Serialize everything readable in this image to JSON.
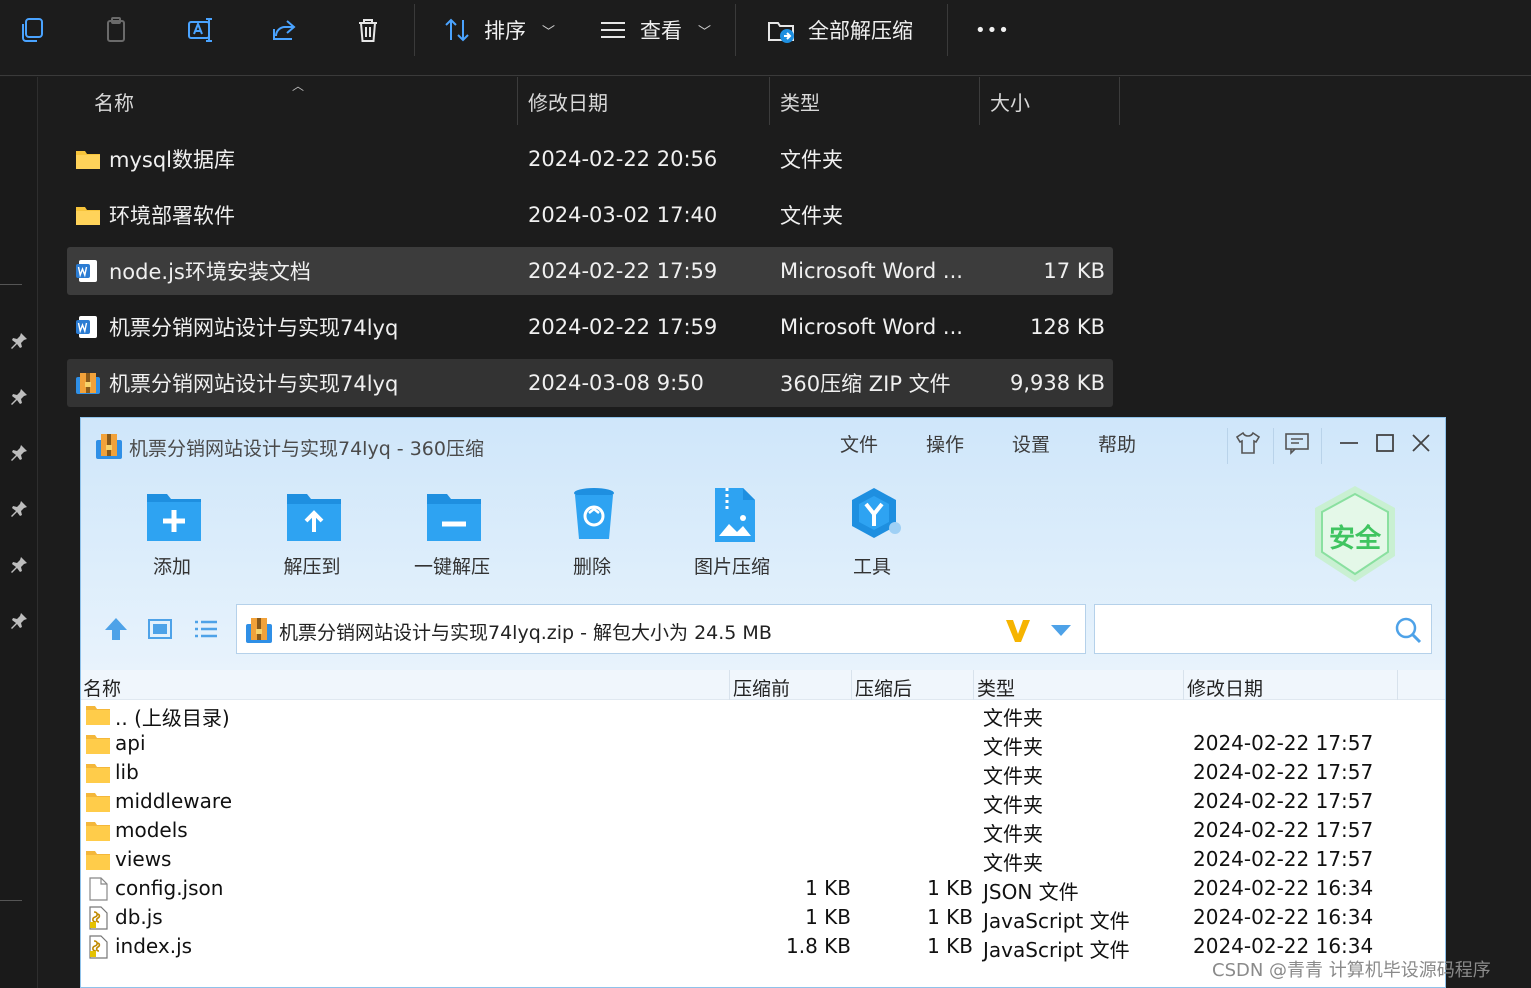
{
  "explorer": {
    "toolbar": {
      "sort_label": "排序",
      "view_label": "查看",
      "extract_all_label": "全部解压缩",
      "more_label": "•••"
    },
    "columns": {
      "name": "名称",
      "modified": "修改日期",
      "type": "类型",
      "size": "大小"
    },
    "files": [
      {
        "name": "mysql数据库",
        "modified": "2024-02-22 20:56",
        "type": "文件夹",
        "size": "",
        "icon": "folder-icon"
      },
      {
        "name": "环境部署软件",
        "modified": "2024-03-02 17:40",
        "type": "文件夹",
        "size": "",
        "icon": "folder-icon"
      },
      {
        "name": "node.js环境安装文档",
        "modified": "2024-02-22 17:59",
        "type": "Microsoft Word ...",
        "size": "17 KB",
        "icon": "word-doc-icon"
      },
      {
        "name": "机票分销网站设计与实现74lyq",
        "modified": "2024-02-22 17:59",
        "type": "Microsoft Word ...",
        "size": "128 KB",
        "icon": "word-doc-icon"
      },
      {
        "name": "机票分销网站设计与实现74lyq",
        "modified": "2024-03-08 9:50",
        "type": "360压缩 ZIP 文件",
        "size": "9,938 KB",
        "icon": "zip-archive-icon"
      }
    ]
  },
  "zip": {
    "title": "机票分销网站设计与实现74lyq - 360压缩",
    "menu": [
      "文件",
      "操作",
      "设置",
      "帮助"
    ],
    "tools": [
      {
        "label": "添加",
        "icon": "add-icon"
      },
      {
        "label": "解压到",
        "icon": "extract-to-icon"
      },
      {
        "label": "一键解压",
        "icon": "one-click-extract-icon"
      },
      {
        "label": "删除",
        "icon": "delete-icon"
      },
      {
        "label": "图片压缩",
        "icon": "image-compress-icon"
      },
      {
        "label": "工具",
        "icon": "tools-icon"
      }
    ],
    "safe_label": "安全",
    "path": "机票分销网站设计与实现74lyq.zip - 解包大小为 24.5 MB",
    "search_value": "",
    "columns": {
      "name": "名称",
      "before": "压缩前",
      "after": "压缩后",
      "type": "类型",
      "modified": "修改日期"
    },
    "entries": [
      {
        "name": ".. (上级目录)",
        "before": "",
        "after": "",
        "type": "文件夹",
        "modified": "",
        "icon": "folder-icon"
      },
      {
        "name": "api",
        "before": "",
        "after": "",
        "type": "文件夹",
        "modified": "2024-02-22 17:57",
        "icon": "folder-icon"
      },
      {
        "name": "lib",
        "before": "",
        "after": "",
        "type": "文件夹",
        "modified": "2024-02-22 17:57",
        "icon": "folder-icon"
      },
      {
        "name": "middleware",
        "before": "",
        "after": "",
        "type": "文件夹",
        "modified": "2024-02-22 17:57",
        "icon": "folder-icon"
      },
      {
        "name": "models",
        "before": "",
        "after": "",
        "type": "文件夹",
        "modified": "2024-02-22 17:57",
        "icon": "folder-icon"
      },
      {
        "name": "views",
        "before": "",
        "after": "",
        "type": "文件夹",
        "modified": "2024-02-22 17:57",
        "icon": "folder-icon"
      },
      {
        "name": "config.json",
        "before": "1 KB",
        "after": "1 KB",
        "type": "JSON 文件",
        "modified": "2024-02-22 16:34",
        "icon": "blank-file-icon"
      },
      {
        "name": "db.js",
        "before": "1 KB",
        "after": "1 KB",
        "type": "JavaScript 文件",
        "modified": "2024-02-22 16:34",
        "icon": "script-file-icon"
      },
      {
        "name": "index.js",
        "before": "1.8 KB",
        "after": "1 KB",
        "type": "JavaScript 文件",
        "modified": "2024-02-22 16:34",
        "icon": "script-file-icon"
      }
    ]
  },
  "watermark": "CSDN @青青  计算机毕设源码程序",
  "colors": {
    "explorer_bg": "#1c1c1c",
    "selection": "#3c3c3c",
    "zip_header": "#d6eafb",
    "zip_accent": "#1e8fe0",
    "safe_green": "#4cc96b"
  }
}
